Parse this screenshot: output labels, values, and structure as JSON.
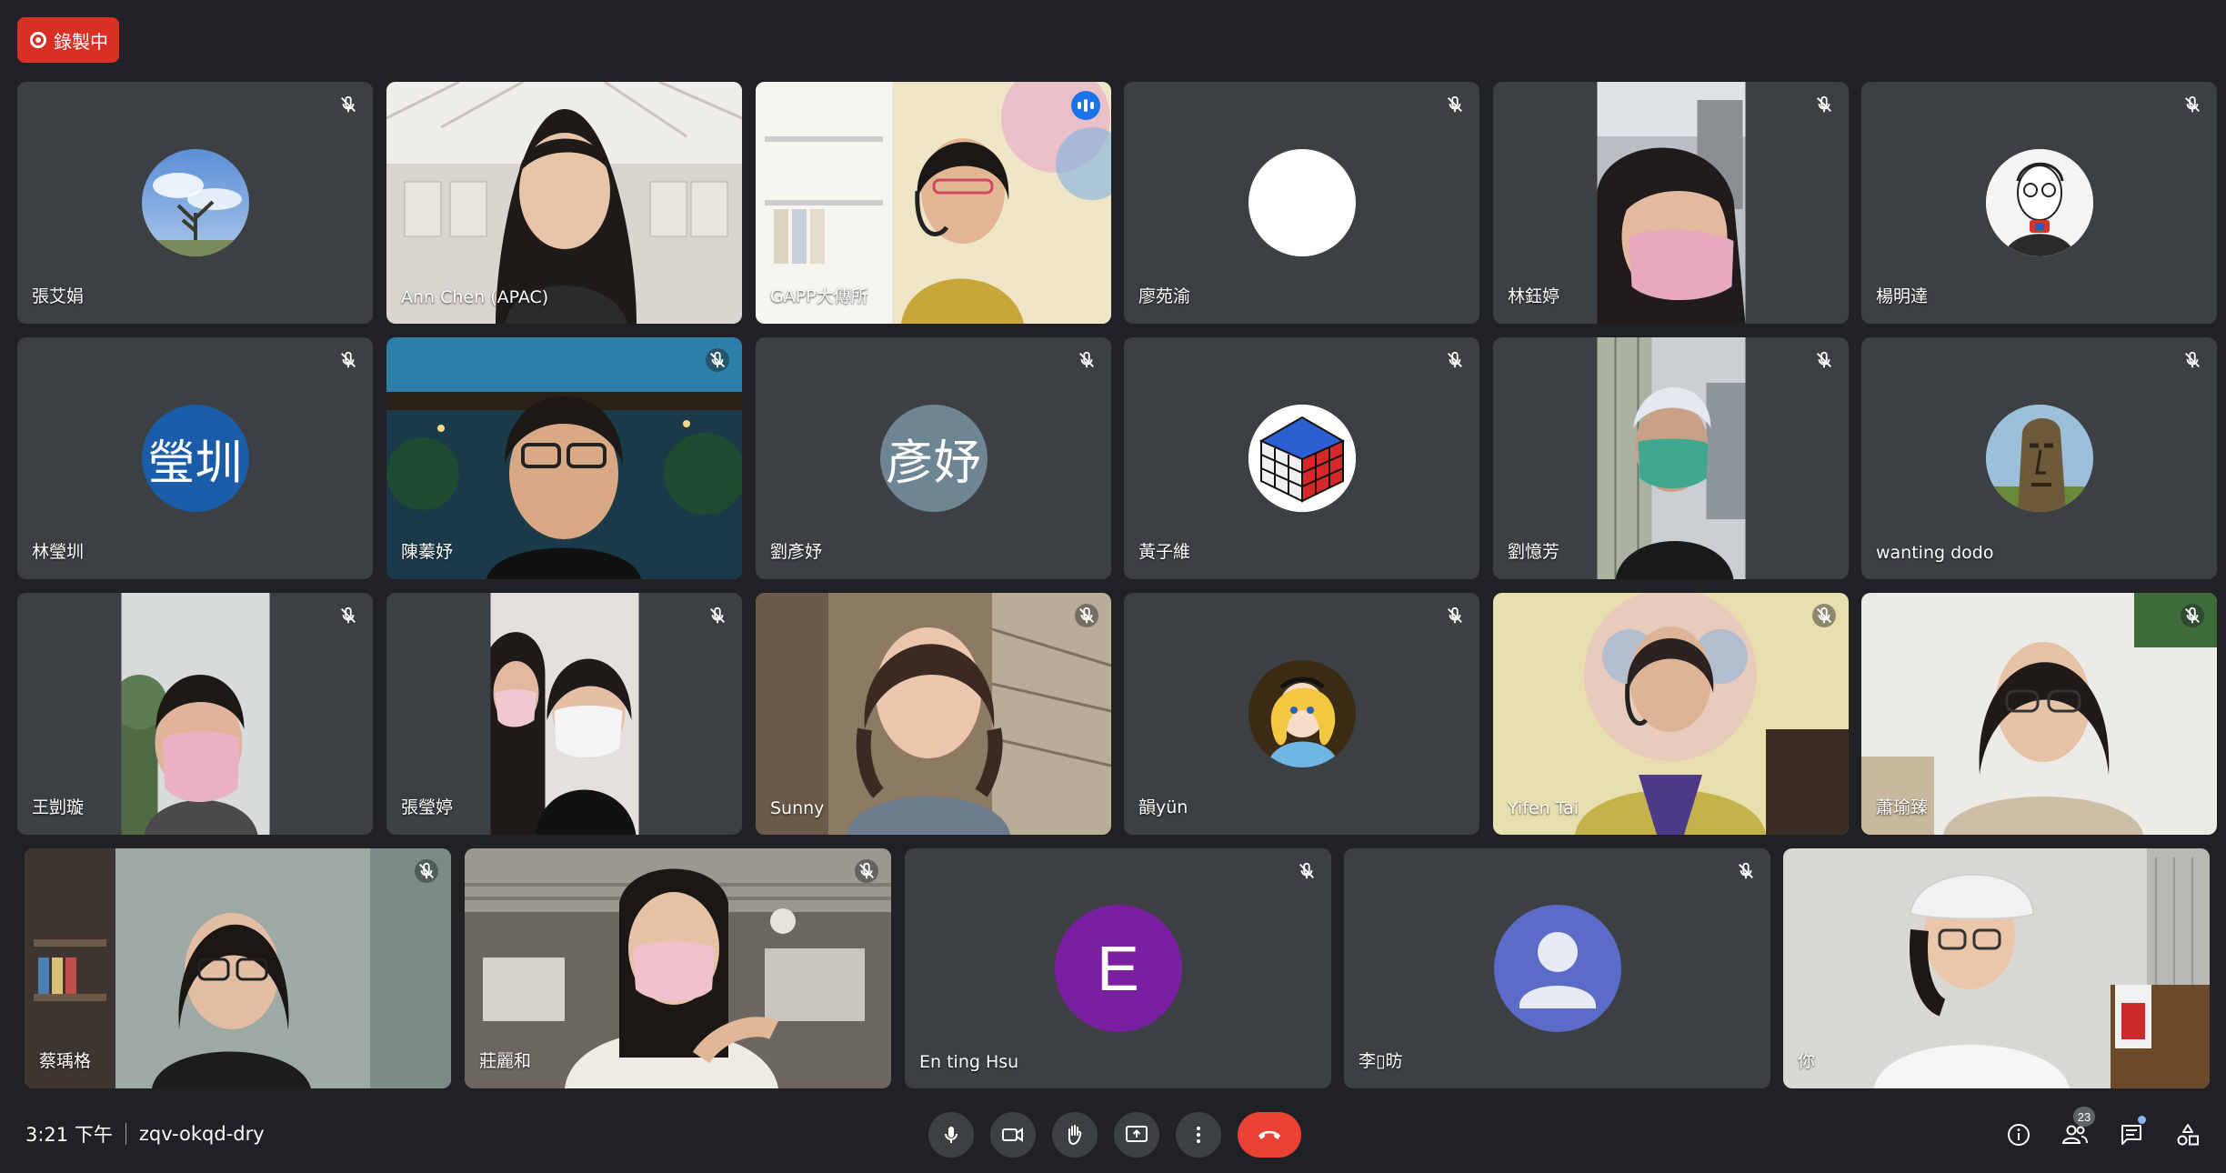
{
  "recording": {
    "label": "錄製中"
  },
  "participants": [
    {
      "name": "張艾娟"
    },
    {
      "name": "Ann Chen (APAC)"
    },
    {
      "name": "GAPP大傳所"
    },
    {
      "name": "廖苑渝"
    },
    {
      "name": "林鈺婷"
    },
    {
      "name": "楊明達"
    },
    {
      "name": "林瑩圳",
      "avatar_text": "瑩圳"
    },
    {
      "name": "陳蓁妤"
    },
    {
      "name": "劉彥妤",
      "avatar_text": "彥妤"
    },
    {
      "name": "黃子維"
    },
    {
      "name": "劉憶芳"
    },
    {
      "name": "wanting dodo"
    },
    {
      "name": "王剴璇"
    },
    {
      "name": "張瑩婷"
    },
    {
      "name": "Sunny"
    },
    {
      "name": "韻yün"
    },
    {
      "name": "Yifen Tai"
    },
    {
      "name": "蕭瑜臻"
    },
    {
      "name": "蔡瑀格"
    },
    {
      "name": "莊麗和"
    },
    {
      "name": "En ting Hsu",
      "avatar_text": "E"
    },
    {
      "name": "李▯昉"
    },
    {
      "name": "你"
    }
  ],
  "colors": {
    "background": "#202124",
    "tile": "#3c4043",
    "speaking_outline": "#8ab4f8",
    "end_call": "#ea4335",
    "recording": "#d93025",
    "avatar_blue": "#1a5ca8",
    "avatar_gray": "#6e8593",
    "avatar_purple": "#7b1fa2",
    "avatar_person": "#5b6bc8"
  },
  "bottom_bar": {
    "time": "3:21 下午",
    "meeting_code": "zqv-okqd-dry",
    "controls": [
      "mic-icon",
      "camera-icon",
      "raise-hand-icon",
      "present-icon",
      "more-icon",
      "end-call-icon"
    ],
    "participants_count": "23",
    "right_icons": [
      "info-icon",
      "people-icon",
      "chat-icon",
      "activities-icon"
    ]
  }
}
